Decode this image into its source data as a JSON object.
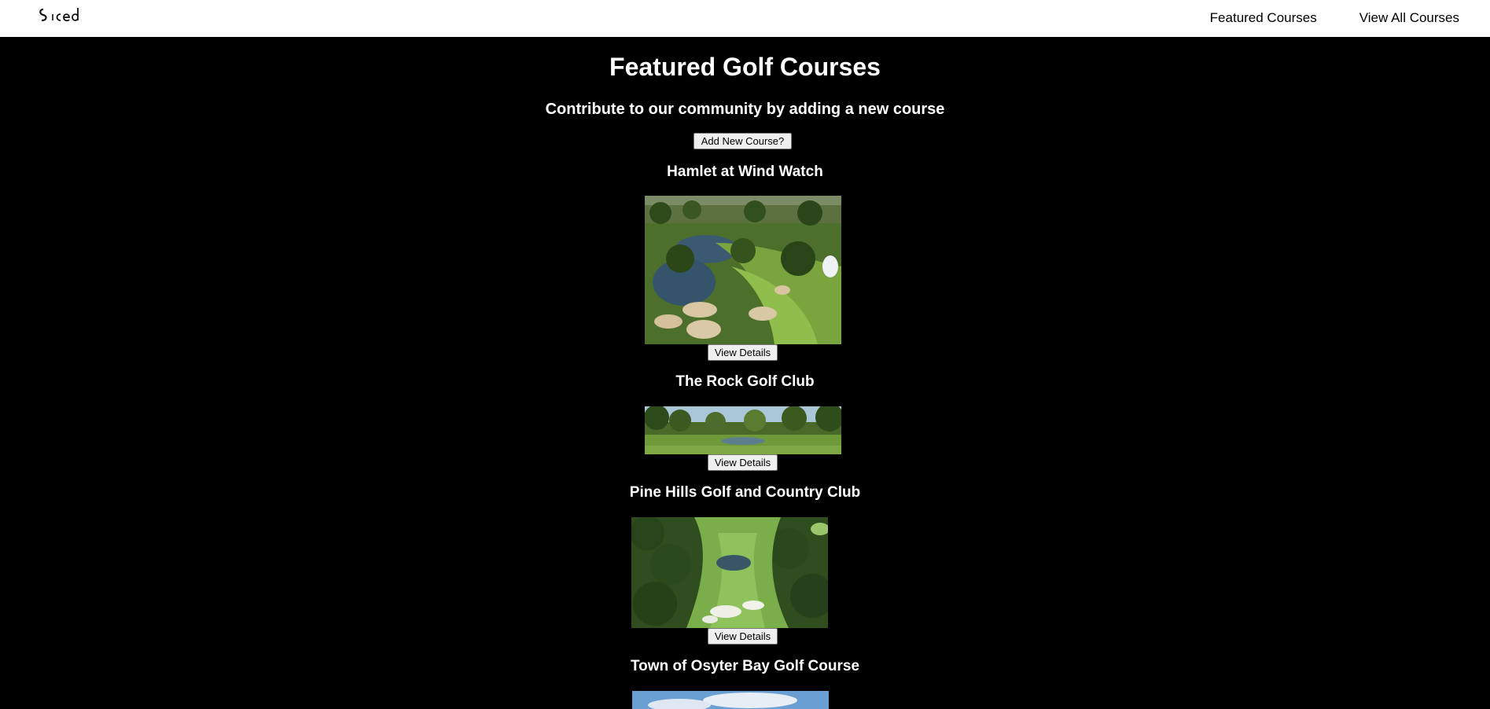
{
  "nav": {
    "logo_alt": "Swed",
    "links": [
      "Featured Courses",
      "View All Courses"
    ]
  },
  "main": {
    "title": "Featured Golf Courses",
    "subtitle": "Contribute to our community by adding a new course",
    "add_button": "Add New Course?",
    "courses": [
      {
        "name": "Hamlet at Wind Watch",
        "button": "View Details"
      },
      {
        "name": "The Rock Golf Club",
        "button": "View Details"
      },
      {
        "name": "Pine Hills Golf and Country Club",
        "button": "View Details"
      },
      {
        "name": "Town of Osyter Bay Golf Course"
      }
    ]
  },
  "colors": {
    "background": "#000000",
    "navbar": "#ffffff",
    "text": "#ffffff"
  }
}
